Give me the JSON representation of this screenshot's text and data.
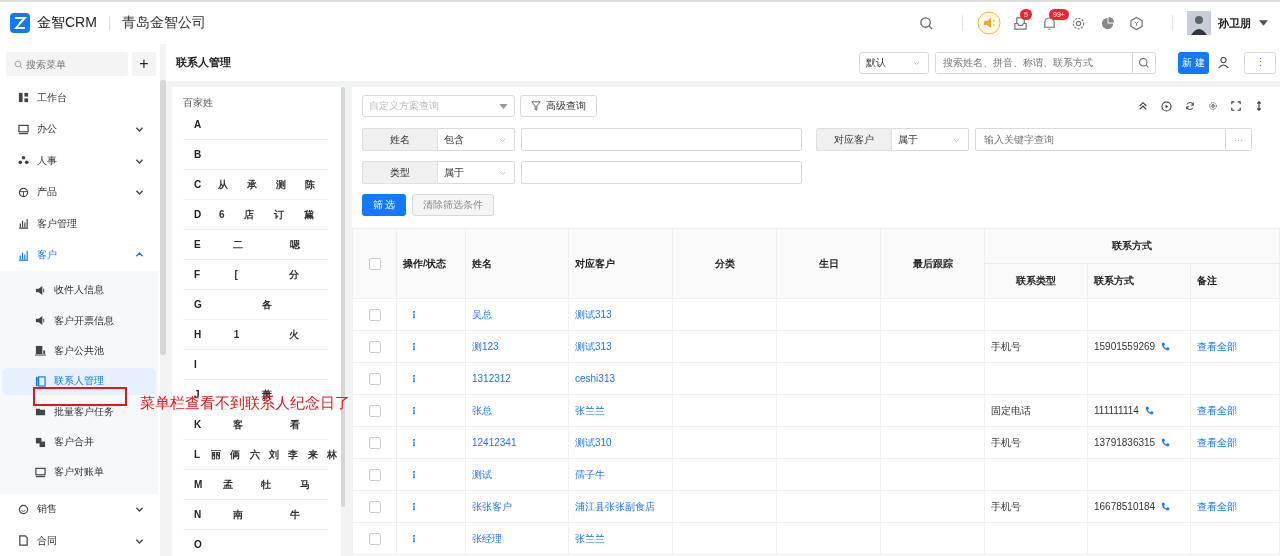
{
  "header": {
    "logo": "金智CRM",
    "company": "青岛金智公司",
    "badges": [
      {
        "kind": "inbox",
        "count": "5"
      },
      {
        "kind": "bell",
        "count": "99+"
      }
    ],
    "user": "孙卫朋"
  },
  "sidebar": {
    "search": {
      "placeholder": "搜索菜单"
    },
    "add": "+",
    "items": [
      {
        "label": "工作台",
        "expandable": false,
        "selected": false
      },
      {
        "label": "办公",
        "expandable": true,
        "expanded": false,
        "selected": false
      },
      {
        "label": "人事",
        "expandable": true,
        "expanded": false,
        "selected": false
      },
      {
        "label": "产品",
        "expandable": true,
        "expanded": false,
        "selected": false
      },
      {
        "label": "客户管理",
        "expandable": false,
        "selected": false
      },
      {
        "label": "客户",
        "expandable": true,
        "expanded": true,
        "selected": true,
        "children": [
          {
            "label": "收件人信息",
            "selected": false
          },
          {
            "label": "客户开票信息",
            "selected": false
          },
          {
            "label": "客户公共池",
            "selected": false
          },
          {
            "label": "联系人管理",
            "selected": true
          },
          {
            "label": "批量客户任务",
            "selected": false
          },
          {
            "label": "客户合并",
            "selected": false
          },
          {
            "label": "客户对账单",
            "selected": false
          }
        ]
      },
      {
        "label": "销售",
        "expandable": true,
        "expanded": false,
        "selected": false
      },
      {
        "label": "合同",
        "expandable": true,
        "expanded": false,
        "selected": false
      }
    ]
  },
  "page": {
    "title": "联系人管理",
    "view": "默认",
    "search": {
      "placeholder": "搜索姓名、拼音、称谓、联系方式"
    },
    "new_button": "新 建"
  },
  "surnames": {
    "title": "百家姓",
    "groups": [
      {
        "letter": "A"
      },
      {
        "letter": "B"
      },
      {
        "letter": "C",
        "names": [
          "从",
          "承",
          "测",
          "陈"
        ]
      },
      {
        "letter": "D",
        "names": [
          "6",
          "店",
          "订",
          "黛"
        ]
      },
      {
        "letter": "E",
        "names": [
          "二",
          "嗯"
        ]
      },
      {
        "letter": "F",
        "names": [
          "[",
          "分"
        ]
      },
      {
        "letter": "G",
        "names": [
          "各"
        ]
      },
      {
        "letter": "H",
        "names": [
          "1",
          "火"
        ]
      },
      {
        "letter": "I"
      },
      {
        "letter": "J",
        "names": [
          "萧"
        ]
      },
      {
        "letter": "K",
        "names": [
          "客",
          "看"
        ]
      },
      {
        "letter": "L",
        "names": [
          "丽",
          "俩",
          "六",
          "刘",
          "李",
          "来",
          "林"
        ]
      },
      {
        "letter": "M",
        "names": [
          "孟",
          "牡",
          "马"
        ]
      },
      {
        "letter": "N",
        "names": [
          "南",
          "牛"
        ]
      },
      {
        "letter": "O"
      }
    ]
  },
  "filters": {
    "scheme": {
      "placeholder": "自定义方案查询"
    },
    "advanced": "高级查询",
    "rows": [
      {
        "label": "姓名",
        "operator": "包含"
      },
      {
        "label": "对应客户",
        "operator": "属于",
        "placeholder": "输入关键字查询",
        "more": "···"
      },
      {
        "label": "类型",
        "operator": "属于"
      }
    ],
    "apply": "筛 选",
    "clear": {
      "label": "清除筛选条件",
      "disabled": true
    }
  },
  "table": {
    "all_checked": false,
    "columns": [
      "操作/状态",
      "姓名",
      "对应客户",
      "分类",
      "生日",
      "最后跟踪"
    ],
    "group": "联系方式",
    "subcolumns": [
      "联系类型",
      "联系方式",
      "备注"
    ],
    "action": "⋮",
    "rows": [
      {
        "checked": false,
        "name": "吴总",
        "customer": "测试313"
      },
      {
        "checked": false,
        "name": "测123",
        "customer": "测试313",
        "contact_type": "手机号",
        "contact": "15901559269",
        "note": "查看全部"
      },
      {
        "checked": false,
        "name": "1312312",
        "customer": "ceshi313"
      },
      {
        "checked": false,
        "name": "张总",
        "customer": "张兰兰",
        "contact_type": "固定电话",
        "contact": "111111114",
        "note": "查看全部"
      },
      {
        "checked": false,
        "name": "12412341",
        "customer": "测试310",
        "contact_type": "手机号",
        "contact": "13791836315",
        "note": "查看全部"
      },
      {
        "checked": false,
        "name": "测试",
        "customer": "孺子牛"
      },
      {
        "checked": false,
        "name": "张张客户",
        "customer": "浦江县张张副食店",
        "contact_type": "手机号",
        "contact": "16678510184",
        "note": "查看全部"
      },
      {
        "checked": false,
        "name": "张经理",
        "customer": "张兰兰"
      }
    ]
  },
  "annotation": {
    "text": "菜单栏查看不到联系人纪念日了"
  }
}
